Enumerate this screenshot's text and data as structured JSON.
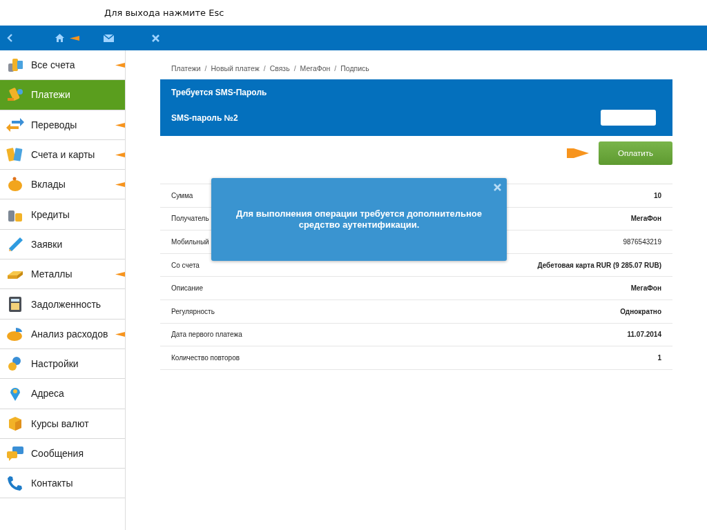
{
  "hint": "Для выхода нажмите Esc",
  "topbar": {
    "buttons": [
      {
        "kind": "back",
        "marked": false
      },
      {
        "kind": "home",
        "marked": true
      },
      {
        "kind": "mail",
        "marked": false
      },
      {
        "kind": "close",
        "marked": false
      }
    ]
  },
  "sidebar": {
    "items": [
      {
        "label": "Все счета",
        "kind": "accounts",
        "selected": false,
        "marked": true
      },
      {
        "label": "Платежи",
        "kind": "payments",
        "selected": true,
        "marked": false
      },
      {
        "label": "Переводы",
        "kind": "transfers",
        "selected": false,
        "marked": true
      },
      {
        "label": "Счета и карты",
        "kind": "cards",
        "selected": false,
        "marked": true
      },
      {
        "label": "Вклады",
        "kind": "deposits",
        "selected": false,
        "marked": true
      },
      {
        "label": "Кредиты",
        "kind": "credits",
        "selected": false,
        "marked": false
      },
      {
        "label": "Заявки",
        "kind": "requests",
        "selected": false,
        "marked": false
      },
      {
        "label": "Металлы",
        "kind": "metals",
        "selected": false,
        "marked": true
      },
      {
        "label": "Задолженность",
        "kind": "debt",
        "selected": false,
        "marked": false
      },
      {
        "label": "Анализ расходов",
        "kind": "analysis",
        "selected": false,
        "marked": true
      },
      {
        "label": "Настройки",
        "kind": "settings",
        "selected": false,
        "marked": false
      },
      {
        "label": "Адреса",
        "kind": "addresses",
        "selected": false,
        "marked": false
      },
      {
        "label": "Курсы валют",
        "kind": "rates",
        "selected": false,
        "marked": false
      },
      {
        "label": "Сообщения",
        "kind": "messages",
        "selected": false,
        "marked": false
      },
      {
        "label": "Контакты",
        "kind": "contacts",
        "selected": false,
        "marked": false
      }
    ]
  },
  "breadcrumb": {
    "separator": "/",
    "items": [
      "Платежи",
      "Новый платеж",
      "Связь",
      "МегаФон",
      "Подпись"
    ]
  },
  "sms_panel": {
    "title": "Требуется SMS-Пароль",
    "field_label": "SMS-пароль №2"
  },
  "pay_button": {
    "label": "Оплатить",
    "marked": true
  },
  "details": [
    {
      "label": "Сумма",
      "value": "10",
      "bold": true
    },
    {
      "label": "Получатель",
      "value": "МегаФон",
      "bold": true
    },
    {
      "label": "Мобильный",
      "value": "9876543219",
      "bold": false
    },
    {
      "label": "Со счета",
      "value": "Дебетовая карта RUR (9 285.07 RUB)",
      "bold": true
    },
    {
      "label": "Описание",
      "value": "МегаФон",
      "bold": true
    },
    {
      "label": "Регулярность",
      "value": "Однократно",
      "bold": true
    },
    {
      "label": "Дата первого платежа",
      "value": "11.07.2014",
      "bold": true
    },
    {
      "label": "Количество повторов",
      "value": "1",
      "bold": true
    }
  ],
  "popup": {
    "message": "Для выполнения операции требуется дополнительное средство аутентификации."
  }
}
